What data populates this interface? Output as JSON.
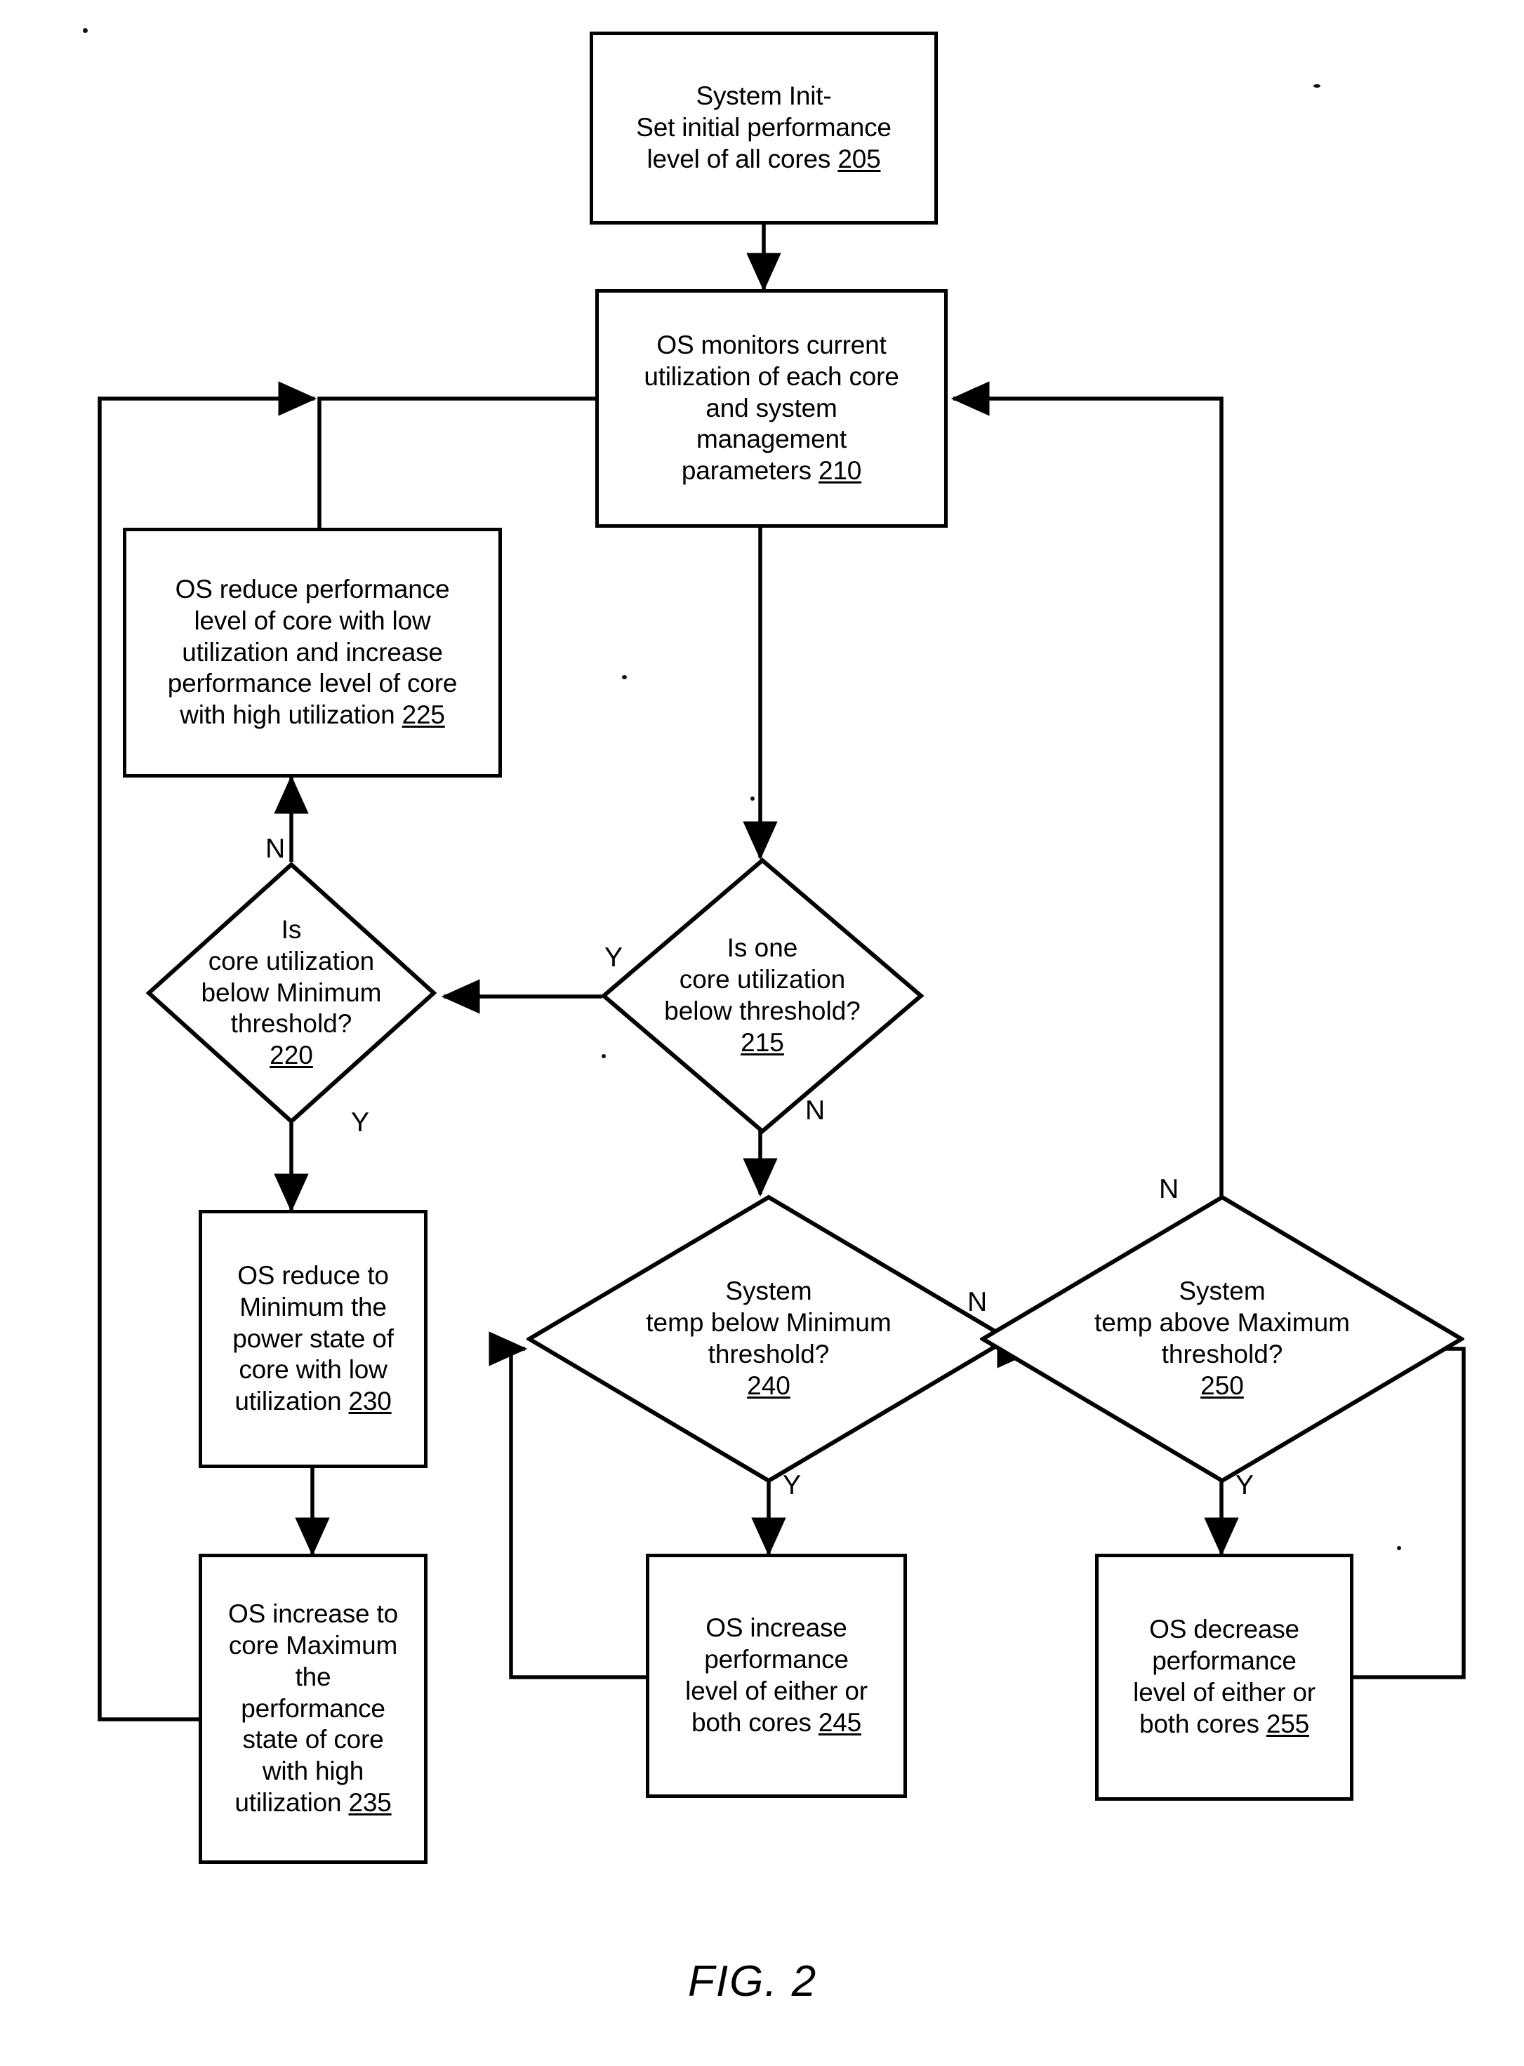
{
  "figure": {
    "caption": "FIG. 2",
    "type": "flowchart"
  },
  "nodes": {
    "n205": {
      "shape": "process",
      "ref": "205",
      "lines": [
        "System Init-",
        "Set initial performance",
        "level of all cores  "
      ],
      "text": "System Init- Set initial performance level of all cores 205"
    },
    "n210": {
      "shape": "process",
      "ref": "210",
      "lines": [
        "OS monitors current",
        "utilization of each core",
        "and system",
        "management",
        "parameters   "
      ],
      "text": "OS monitors current utilization of each core and system management parameters 210"
    },
    "n215": {
      "shape": "decision",
      "ref": "215",
      "lines": [
        "Is one",
        "core utilization",
        "below threshold?"
      ],
      "text": "Is one core utilization below threshold? 215"
    },
    "n220": {
      "shape": "decision",
      "ref": "220",
      "lines": [
        "Is",
        "core utilization",
        "below Minimum",
        "threshold?"
      ],
      "text": "Is core utilization below Minimum threshold? 220"
    },
    "n225": {
      "shape": "process",
      "ref": "225",
      "lines": [
        "OS reduce performance",
        "level of core with low",
        "utilization and increase",
        "performance level of core",
        "with high utilization "
      ],
      "text": "OS reduce performance level of core with low utilization and increase performance level of core with high utilization 225"
    },
    "n230": {
      "shape": "process",
      "ref": "230",
      "lines": [
        "OS reduce to",
        "Minimum the",
        "power state of",
        "core with low",
        "utilization "
      ],
      "text": "OS reduce to Minimum the power state of core with low utilization 230"
    },
    "n235": {
      "shape": "process",
      "ref": "235",
      "lines": [
        "OS increase to",
        "core Maximum",
        "the",
        "performance",
        "state of core",
        "with high",
        "utilization "
      ],
      "text": "OS increase to core Maximum the performance state of core with high utilization 235"
    },
    "n240": {
      "shape": "decision",
      "ref": "240",
      "lines": [
        "System",
        "temp below Minimum",
        "threshold?"
      ],
      "text": "System temp below Minimum threshold? 240"
    },
    "n245": {
      "shape": "process",
      "ref": "245",
      "lines": [
        "OS increase",
        "performance",
        "level of either or",
        "both cores  "
      ],
      "text": "OS increase performance level of either or both cores 245"
    },
    "n250": {
      "shape": "decision",
      "ref": "250",
      "lines": [
        "System",
        "temp above Maximum",
        "threshold?"
      ],
      "text": "System temp above Maximum threshold? 250"
    },
    "n255": {
      "shape": "process",
      "ref": "255",
      "lines": [
        "OS decrease",
        "performance",
        "level of either  or",
        "both cores  "
      ],
      "text": "OS decrease performance level of either or both cores 255"
    }
  },
  "branch_labels": {
    "b215_yes": "Y",
    "b215_no": "N",
    "b220_no": "N",
    "b220_yes": "Y",
    "b240_no": "N",
    "b240_yes": "Y",
    "b250_no": "N",
    "b250_yes": "Y"
  },
  "edges": [
    {
      "from": "n205",
      "to": "n210",
      "label": ""
    },
    {
      "from": "n210",
      "to": "n215",
      "label": ""
    },
    {
      "from": "n215",
      "to": "n220",
      "label": "Y"
    },
    {
      "from": "n215",
      "to": "n240",
      "label": "N"
    },
    {
      "from": "n220",
      "to": "n225",
      "label": "N"
    },
    {
      "from": "n220",
      "to": "n230",
      "label": "Y"
    },
    {
      "from": "n225",
      "to": "n210",
      "label": ""
    },
    {
      "from": "n230",
      "to": "n235",
      "label": ""
    },
    {
      "from": "n235",
      "to": "n210",
      "label": ""
    },
    {
      "from": "n240",
      "to": "n245",
      "label": "Y"
    },
    {
      "from": "n240",
      "to": "n250",
      "label": "N"
    },
    {
      "from": "n245",
      "to": "n240",
      "label": ""
    },
    {
      "from": "n250",
      "to": "n255",
      "label": "Y"
    },
    {
      "from": "n250",
      "to": "n210",
      "label": "N"
    },
    {
      "from": "n255",
      "to": "n250",
      "label": ""
    }
  ],
  "colors": {
    "line": "#000000",
    "background": "#ffffff",
    "text": "#000000"
  }
}
